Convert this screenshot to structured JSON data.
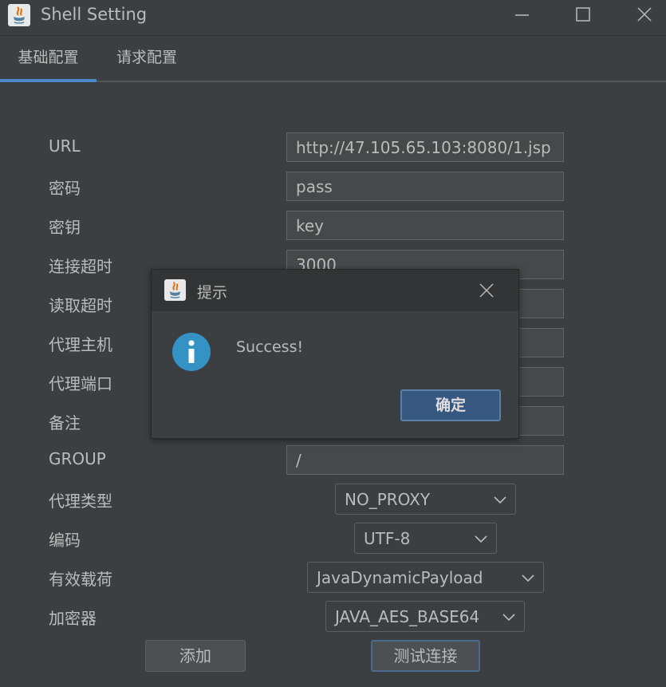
{
  "window": {
    "title": "Shell Setting"
  },
  "tabs": [
    {
      "label": "基础配置",
      "active": true
    },
    {
      "label": "请求配置",
      "active": false
    }
  ],
  "fields": {
    "url": {
      "label": "URL",
      "value": "http://47.105.65.103:8080/1.jsp"
    },
    "password": {
      "label": "密码",
      "value": "pass"
    },
    "key": {
      "label": "密钥",
      "value": "key"
    },
    "connect_timeout": {
      "label": "连接超时",
      "value": "3000"
    },
    "read_timeout": {
      "label": "读取超时",
      "value": ""
    },
    "proxy_host": {
      "label": "代理主机",
      "value": ""
    },
    "proxy_port": {
      "label": "代理端口",
      "value": ""
    },
    "remark": {
      "label": "备注",
      "value": ""
    },
    "group": {
      "label": "GROUP",
      "value": "/"
    }
  },
  "selects": {
    "proxy_type": {
      "label": "代理类型",
      "value": "NO_PROXY"
    },
    "encoding": {
      "label": "编码",
      "value": "UTF-8"
    },
    "payload": {
      "label": "有效载荷",
      "value": "JavaDynamicPayload"
    },
    "cryption": {
      "label": "加密器",
      "value": "JAVA_AES_BASE64"
    }
  },
  "buttons": {
    "add": "添加",
    "test": "测试连接"
  },
  "dialog": {
    "title": "提示",
    "message": "Success!",
    "ok": "确定"
  },
  "colors": {
    "background": "#3c3f41",
    "accent": "#4a88c7",
    "info": "#3592c4",
    "ok_button": "#365880"
  }
}
